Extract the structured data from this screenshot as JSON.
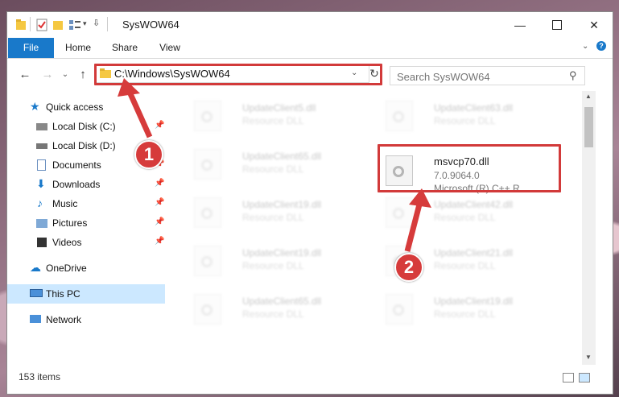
{
  "window": {
    "title": "SysWOW64"
  },
  "ribbon": {
    "tabs": [
      "File",
      "Home",
      "Share",
      "View"
    ]
  },
  "address": {
    "path": "C:\\Windows\\SysWOW64"
  },
  "search": {
    "placeholder": "Search SysWOW64"
  },
  "sidebar": {
    "items": [
      {
        "label": "Quick access",
        "icon": "star-icon",
        "pinned": false
      },
      {
        "label": "Local Disk (C:)",
        "icon": "drive-icon",
        "pinned": true
      },
      {
        "label": "Local Disk (D:)",
        "icon": "drive-icon",
        "pinned": false
      },
      {
        "label": "Documents",
        "icon": "documents-icon",
        "pinned": true
      },
      {
        "label": "Downloads",
        "icon": "download-icon",
        "pinned": true
      },
      {
        "label": "Music",
        "icon": "music-icon",
        "pinned": true
      },
      {
        "label": "Pictures",
        "icon": "pictures-icon",
        "pinned": true
      },
      {
        "label": "Videos",
        "icon": "videos-icon",
        "pinned": true
      },
      {
        "label": "OneDrive",
        "icon": "cloud-icon",
        "pinned": false
      },
      {
        "label": "This PC",
        "icon": "computer-icon",
        "pinned": false
      },
      {
        "label": "Network",
        "icon": "network-icon",
        "pinned": false
      }
    ]
  },
  "files": {
    "left": [
      {
        "name": "UpdateClient5.dll",
        "type": "Resource DLL"
      },
      {
        "name": "UpdateClient65.dll",
        "type": "Resource DLL"
      },
      {
        "name": "UpdateClient19.dll",
        "type": "Resource DLL"
      },
      {
        "name": "UpdateClient19.dll",
        "type": "Resource DLL"
      },
      {
        "name": "UpdateClient65.dll",
        "type": "Resource DLL"
      }
    ],
    "right": [
      {
        "name": "UpdateClient63.dll",
        "type": "Resource DLL"
      },
      {
        "name": "msvcp70.dll",
        "version": "7.0.9064.0",
        "company": "Microsoft (R) C++ R..."
      },
      {
        "name": "UpdateClient42.dll",
        "type": "Resource DLL"
      },
      {
        "name": "UpdateClient21.dll",
        "type": "Resource DLL"
      },
      {
        "name": "UpdateClient19.dll",
        "type": "Resource DLL"
      }
    ]
  },
  "status": {
    "count": "153 items"
  },
  "annotations": {
    "step1": "1",
    "step2": "2"
  },
  "colors": {
    "accent": "#1979ca",
    "highlight": "#d23a3a"
  }
}
